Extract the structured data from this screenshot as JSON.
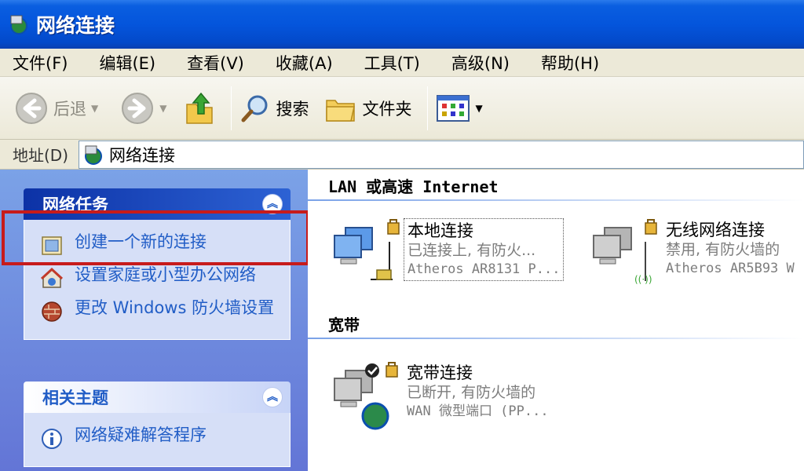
{
  "window": {
    "title": "网络连接"
  },
  "menu": [
    "文件(F)",
    "编辑(E)",
    "查看(V)",
    "收藏(A)",
    "工具(T)",
    "高级(N)",
    "帮助(H)"
  ],
  "toolbar": {
    "back": "后退",
    "search": "搜索",
    "folders": "文件夹"
  },
  "address": {
    "label": "地址(D)",
    "value": "网络连接"
  },
  "tasks_panel": {
    "title": "网络任务",
    "items": [
      {
        "label": "创建一个新的连接",
        "icon": "new-connection-icon"
      },
      {
        "label": "设置家庭或小型办公网络",
        "icon": "home-network-icon"
      },
      {
        "label": "更改 Windows 防火墙设置",
        "icon": "firewall-icon"
      }
    ]
  },
  "related_panel": {
    "title": "相关主题",
    "items": [
      {
        "label": "网络疑难解答程序",
        "icon": "info-icon"
      }
    ]
  },
  "groups": [
    {
      "title": "LAN 或高速 Internet",
      "connections": [
        {
          "name": "本地连接",
          "status": "已连接上, 有防火...",
          "device": "Atheros AR8131 P..."
        },
        {
          "name": "无线网络连接",
          "status": "禁用, 有防火墙的",
          "device": "Atheros AR5B93 W"
        }
      ]
    },
    {
      "title": "宽带",
      "connections": [
        {
          "name": "宽带连接",
          "status": "已断开, 有防火墙的",
          "device": "WAN 微型端口 (PP..."
        }
      ]
    }
  ],
  "colors": {
    "titlebar": "#0455dc",
    "taskpane": "#7ba2e7",
    "link": "#215dc6",
    "highlight": "#c71b1b"
  }
}
